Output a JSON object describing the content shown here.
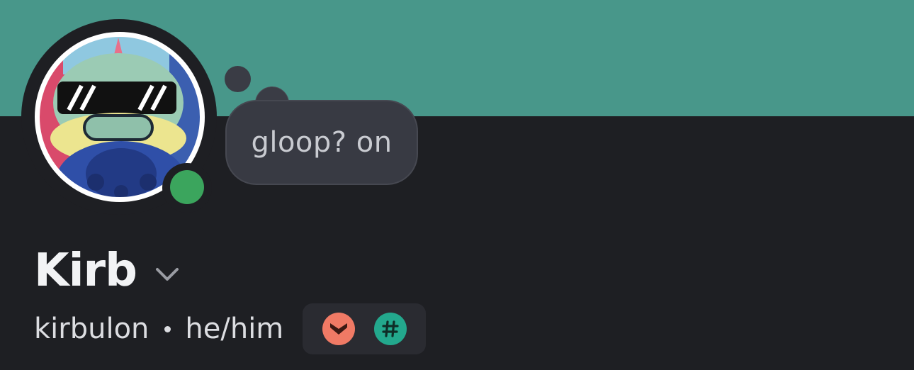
{
  "profile": {
    "display_name": "Kirb",
    "username": "kirbulon",
    "separator": "•",
    "pronouns": "he/him",
    "status": "online",
    "custom_status": "gloop? on"
  },
  "icons": {
    "avatar": "avatar-image",
    "status": "online-status-icon",
    "expand": "chevron-down-icon",
    "badge_1": "chevrons-down-badge-icon",
    "badge_2": "hashtag-badge-icon"
  },
  "colors": {
    "banner": "#48978a",
    "background": "#1e1f23",
    "online_status": "#3ba55d",
    "badge_1": "#f07a65",
    "badge_2": "#23a88d"
  }
}
